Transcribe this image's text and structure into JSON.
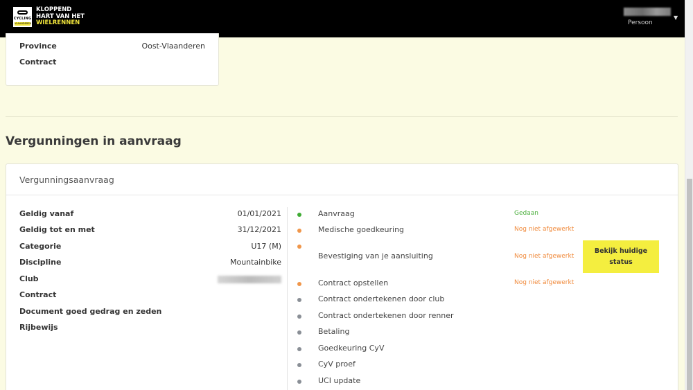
{
  "header": {
    "logo": {
      "line1": "KLOPPEND",
      "line2": "HART VAN HET",
      "line3": "WIELRENNEN",
      "badge_text": "CYCLING",
      "badge_sub": "VLAANDEREN"
    },
    "user": {
      "role": "Persoon"
    }
  },
  "profile_card": {
    "rows": [
      {
        "label": "Province",
        "value": "Oost-Vlaanderen"
      },
      {
        "label": "Contract",
        "value": ""
      }
    ]
  },
  "section": {
    "title": "Vergunningen in aanvraag"
  },
  "application": {
    "card_title": "Vergunningsaanvraag",
    "details": [
      {
        "label": "Geldig vanaf",
        "value": "01/01/2021"
      },
      {
        "label": "Geldig tot en met",
        "value": "31/12/2021"
      },
      {
        "label": "Categorie",
        "value": "U17 (M)"
      },
      {
        "label": "Discipline",
        "value": "Mountainbike"
      },
      {
        "label": "Club",
        "value": ""
      },
      {
        "label": "Contract",
        "value": ""
      },
      {
        "label": "Document goed gedrag en zeden",
        "value": ""
      },
      {
        "label": "Rijbewijs",
        "value": ""
      }
    ],
    "steps": [
      {
        "name": "Aanvraag",
        "status": "Gedaan",
        "state": "done"
      },
      {
        "name": "Medische goedkeuring",
        "status": "Nog niet afgewerkt",
        "state": "todo"
      },
      {
        "name": "Bevestiging van je aansluiting",
        "status": "Nog niet afgewerkt",
        "state": "todo"
      },
      {
        "name": "Contract opstellen",
        "status": "Nog niet afgewerkt",
        "state": "todo"
      },
      {
        "name": "Contract ondertekenen door club",
        "status": "",
        "state": "pending"
      },
      {
        "name": "Contract ondertekenen door renner",
        "status": "",
        "state": "pending"
      },
      {
        "name": "Betaling",
        "status": "",
        "state": "pending"
      },
      {
        "name": "Goedkeuring CyV",
        "status": "",
        "state": "pending"
      },
      {
        "name": "CyV proef",
        "status": "",
        "state": "pending"
      },
      {
        "name": "UCI update",
        "status": "",
        "state": "pending"
      }
    ],
    "status_button": "Bekijk huidige status"
  },
  "colors": {
    "background": "#fbfbe3",
    "accent_yellow": "#f4ee3f",
    "done_green": "#3fab34",
    "todo_orange": "#f0964a",
    "pending_gray": "#8a8f96"
  }
}
